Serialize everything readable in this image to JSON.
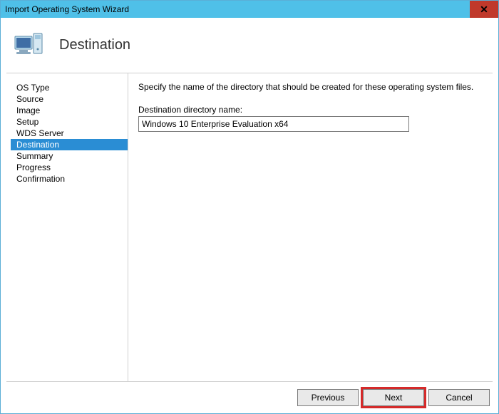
{
  "window": {
    "title": "Import Operating System Wizard"
  },
  "header": {
    "title": "Destination"
  },
  "sidebar": {
    "items": [
      {
        "label": "OS Type"
      },
      {
        "label": "Source"
      },
      {
        "label": "Image"
      },
      {
        "label": "Setup"
      },
      {
        "label": "WDS Server"
      },
      {
        "label": "Destination",
        "selected": true
      },
      {
        "label": "Summary"
      },
      {
        "label": "Progress"
      },
      {
        "label": "Confirmation"
      }
    ]
  },
  "main": {
    "instruction": "Specify the name of the directory that should be created for these operating system files.",
    "field_label": "Destination directory name:",
    "field_value": "Windows 10 Enterprise Evaluation x64"
  },
  "footer": {
    "previous": "Previous",
    "next": "Next",
    "cancel": "Cancel"
  }
}
